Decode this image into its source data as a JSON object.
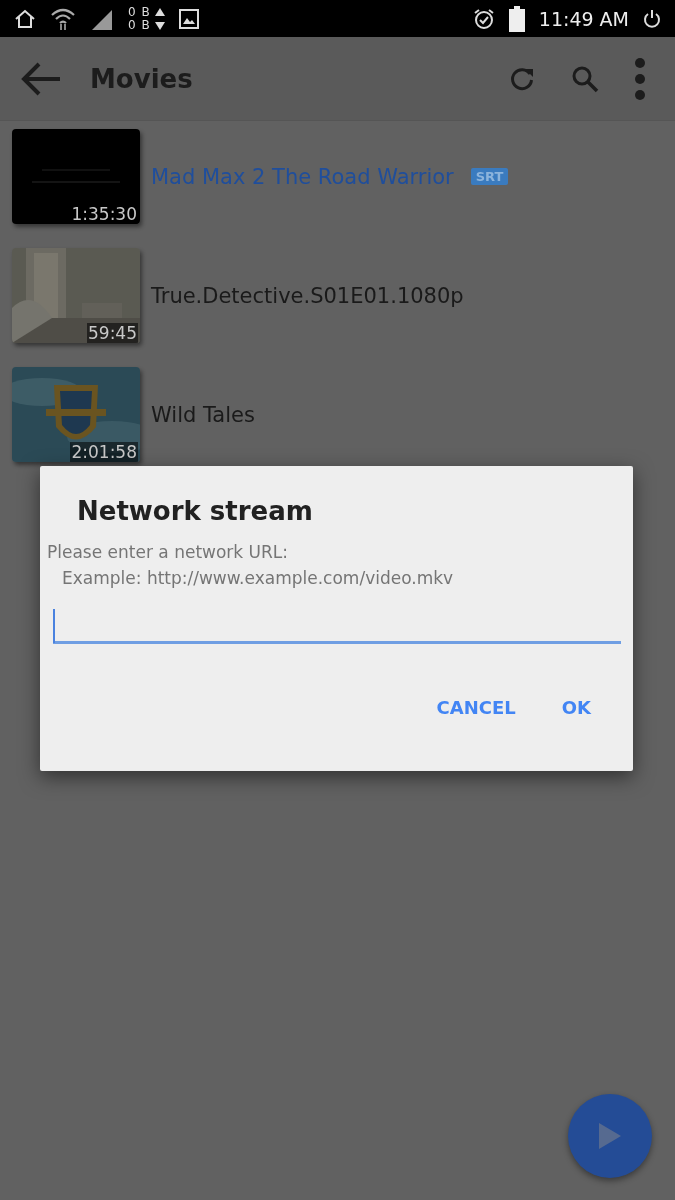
{
  "status_bar": {
    "upload": "0 B",
    "download": "0 B",
    "time": "11:49 AM"
  },
  "app_bar": {
    "title": "Movies"
  },
  "videos": [
    {
      "title": "Mad Max 2 The Road Warrior",
      "badge": "SRT",
      "duration": "1:35:30",
      "selected": true
    },
    {
      "title": "True.Detective.S01E01.1080p",
      "duration": "59:45",
      "selected": false
    },
    {
      "title": "Wild Tales",
      "duration": "2:01:58",
      "selected": false
    }
  ],
  "dialog": {
    "title": "Network stream",
    "message": "Please enter a network URL:",
    "example": "Example: http://www.example.com/video.mkv",
    "buttons": [
      "CANCEL",
      "OK"
    ]
  }
}
